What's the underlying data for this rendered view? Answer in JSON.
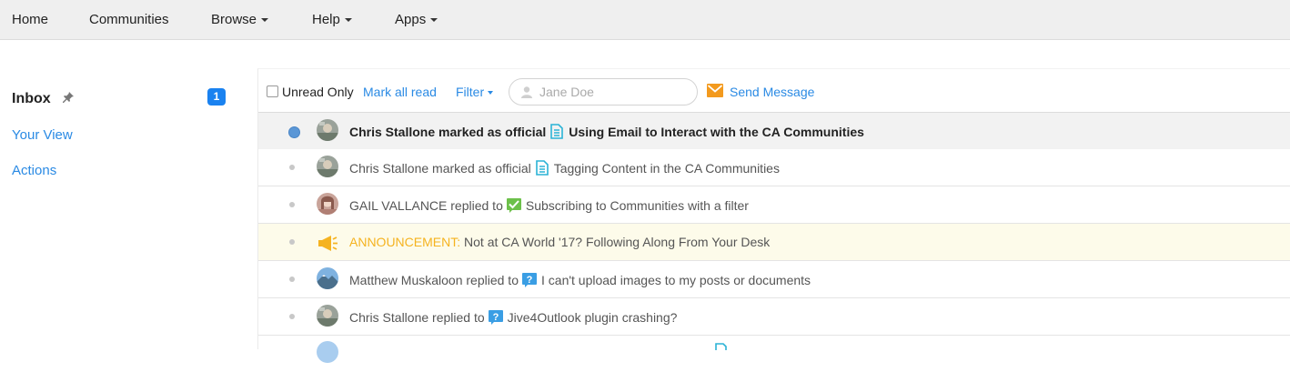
{
  "nav": {
    "items": [
      {
        "label": "Home",
        "dropdown": false
      },
      {
        "label": "Communities",
        "dropdown": false
      },
      {
        "label": "Browse",
        "dropdown": true
      },
      {
        "label": "Help",
        "dropdown": true
      },
      {
        "label": "Apps",
        "dropdown": true
      }
    ]
  },
  "sidebar": {
    "title": "Inbox",
    "badge": "1",
    "links": [
      "Your View",
      "Actions"
    ]
  },
  "toolbar": {
    "unread_only": "Unread Only",
    "mark_all_read": "Mark all read",
    "filter": "Filter",
    "search_placeholder": "Jane Doe",
    "send_message": "Send Message"
  },
  "rows": [
    {
      "actor": "Chris Stallone marked as official",
      "icon": "document-icon",
      "target": "Using Email to Interact with the CA Communities",
      "unread": true
    },
    {
      "actor": "Chris Stallone marked as official",
      "icon": "document-icon",
      "target": "Tagging Content in the CA Communities",
      "unread": false
    },
    {
      "actor": "GAIL VALLANCE replied to",
      "icon": "answered-question-icon",
      "target": "Subscribing to Communities with a filter",
      "unread": false
    },
    {
      "actor": "ANNOUNCEMENT:",
      "icon": "megaphone-icon",
      "target": "Not at CA World '17? Following Along From Your Desk",
      "unread": false
    },
    {
      "actor": "Matthew Muskaloon replied to",
      "icon": "question-icon",
      "target": "I can't upload images to my posts or documents",
      "unread": false
    },
    {
      "actor": "Chris Stallone replied to",
      "icon": "question-icon",
      "target": "Jive4Outlook plugin crashing?",
      "unread": false
    }
  ],
  "colors": {
    "link": "#2a8ae4",
    "badge": "#1a82f0",
    "announcement": "#f5b320",
    "document_icon": "#2bb3d6",
    "answered_icon": "#6cc04a",
    "question_icon": "#3a9ee4",
    "mail_icon": "#f39a1e"
  }
}
